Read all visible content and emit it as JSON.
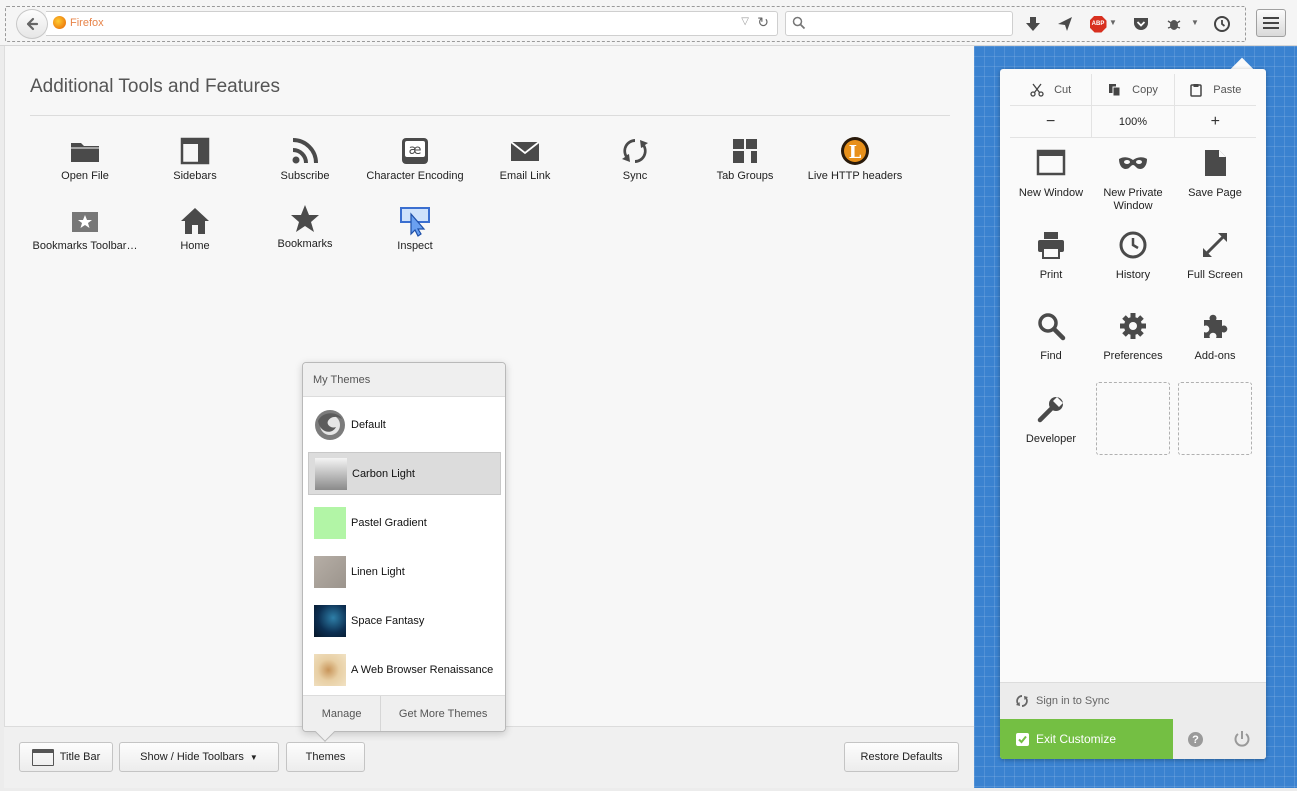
{
  "browser": {
    "url_label": "Firefox",
    "search_placeholder": ""
  },
  "palette": {
    "title": "Additional Tools and Features",
    "items": [
      {
        "label": "Open File",
        "icon": "folder-icon"
      },
      {
        "label": "Sidebars",
        "icon": "sidebar-icon"
      },
      {
        "label": "Subscribe",
        "icon": "rss-icon"
      },
      {
        "label": "Character Encoding",
        "icon": "character-encoding-icon"
      },
      {
        "label": "Email Link",
        "icon": "email-icon"
      },
      {
        "label": "Sync",
        "icon": "sync-icon"
      },
      {
        "label": "Tab Groups",
        "icon": "tab-groups-icon"
      },
      {
        "label": "Live HTTP headers",
        "icon": "live-http-headers-icon"
      },
      {
        "label": "Bookmarks Toolbar…",
        "icon": "bookmarks-toolbar-icon"
      },
      {
        "label": "Home",
        "icon": "home-icon"
      },
      {
        "label": "Bookmarks",
        "icon": "star-icon"
      },
      {
        "label": "Inspect",
        "icon": "inspect-icon"
      }
    ]
  },
  "themes_popup": {
    "header": "My Themes",
    "items": [
      {
        "label": "Default",
        "thumb": "default-theme"
      },
      {
        "label": "Carbon Light",
        "thumb": "carbon-light"
      },
      {
        "label": "Pastel Gradient",
        "thumb": "pastel-gradient"
      },
      {
        "label": "Linen Light",
        "thumb": "linen-light"
      },
      {
        "label": "Space Fantasy",
        "thumb": "space-fantasy"
      },
      {
        "label": "A Web Browser Renaissance",
        "thumb": "renaissance"
      }
    ],
    "selected": "Carbon Light",
    "manage": "Manage",
    "get_more": "Get More Themes"
  },
  "bottom_bar": {
    "title_bar": "Title Bar",
    "show_hide_toolbars": "Show / Hide Toolbars",
    "themes": "Themes",
    "restore_defaults": "Restore Defaults"
  },
  "menu_panel": {
    "edit": {
      "cut": "Cut",
      "copy": "Copy",
      "paste": "Paste"
    },
    "zoom": {
      "minus": "−",
      "value": "100%",
      "plus": "+"
    },
    "items": [
      {
        "label": "New Window",
        "icon": "new-window-icon"
      },
      {
        "label": "New Private Window",
        "icon": "private-mask-icon"
      },
      {
        "label": "Save Page",
        "icon": "save-page-icon"
      },
      {
        "label": "Print",
        "icon": "printer-icon"
      },
      {
        "label": "History",
        "icon": "clock-icon"
      },
      {
        "label": "Full Screen",
        "icon": "fullscreen-icon"
      },
      {
        "label": "Find",
        "icon": "magnifier-icon"
      },
      {
        "label": "Preferences",
        "icon": "gear-icon"
      },
      {
        "label": "Add-ons",
        "icon": "puzzle-icon"
      },
      {
        "label": "Developer",
        "icon": "wrench-icon"
      }
    ],
    "sync": "Sign in to Sync",
    "exit": "Exit Customize",
    "help": "?"
  },
  "colors": {
    "accent_green": "#74bf43",
    "customize_blue": "#3a82d0"
  }
}
